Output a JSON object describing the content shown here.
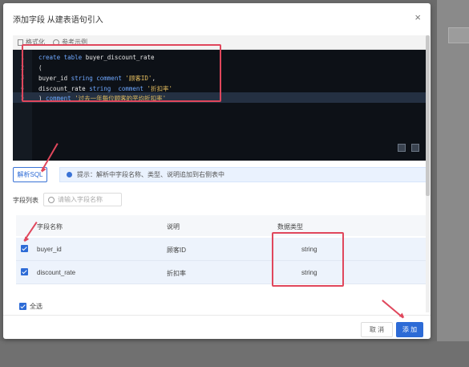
{
  "dialog": {
    "title": "添加字段 从建表语句引入",
    "close_glyph": "×"
  },
  "editor": {
    "toolbar": {
      "format_label": "格式化",
      "example_label": "参考示例"
    },
    "lines": [
      {
        "num": "1",
        "parts": [
          {
            "t": "create table ",
            "c": "kw"
          },
          {
            "t": "buyer_discount_rate",
            "c": ""
          }
        ]
      },
      {
        "num": "2",
        "parts": [
          {
            "t": "(",
            "c": ""
          }
        ]
      },
      {
        "num": "3",
        "parts": [
          {
            "t": "buyer_id ",
            "c": ""
          },
          {
            "t": "string comment ",
            "c": "kw"
          },
          {
            "t": "'顾客ID'",
            "c": "str"
          },
          {
            "t": ",",
            "c": ""
          }
        ]
      },
      {
        "num": "4",
        "parts": [
          {
            "t": "discount_rate ",
            "c": ""
          },
          {
            "t": "string  comment ",
            "c": "kw"
          },
          {
            "t": "'折扣率'",
            "c": "str"
          }
        ]
      },
      {
        "num": "5",
        "parts": [
          {
            "t": ") ",
            "c": ""
          },
          {
            "t": "comment ",
            "c": "kw"
          },
          {
            "t": "'过去一年每位顾客的平均折扣率'",
            "c": "str"
          }
        ]
      }
    ]
  },
  "parse": {
    "button_label": "解析SQL",
    "tip": "提示：解析中字段名称、类型、说明追加到右侧表中"
  },
  "fields": {
    "label": "字段列表",
    "search_placeholder": "请输入字段名称",
    "columns": [
      "字段名称",
      "说明",
      "数据类型"
    ],
    "rows": [
      {
        "name": "buyer_id",
        "desc": "顾客ID",
        "type": "string",
        "checked": true
      },
      {
        "name": "discount_rate",
        "desc": "折扣率",
        "type": "string",
        "checked": true
      }
    ],
    "select_all_label": "全选"
  },
  "footer": {
    "cancel_label": "取 消",
    "add_label": "添 加"
  },
  "colors": {
    "primary": "#2d6bd6",
    "annotation": "#e0475c",
    "editor_bg": "#0d1117"
  }
}
